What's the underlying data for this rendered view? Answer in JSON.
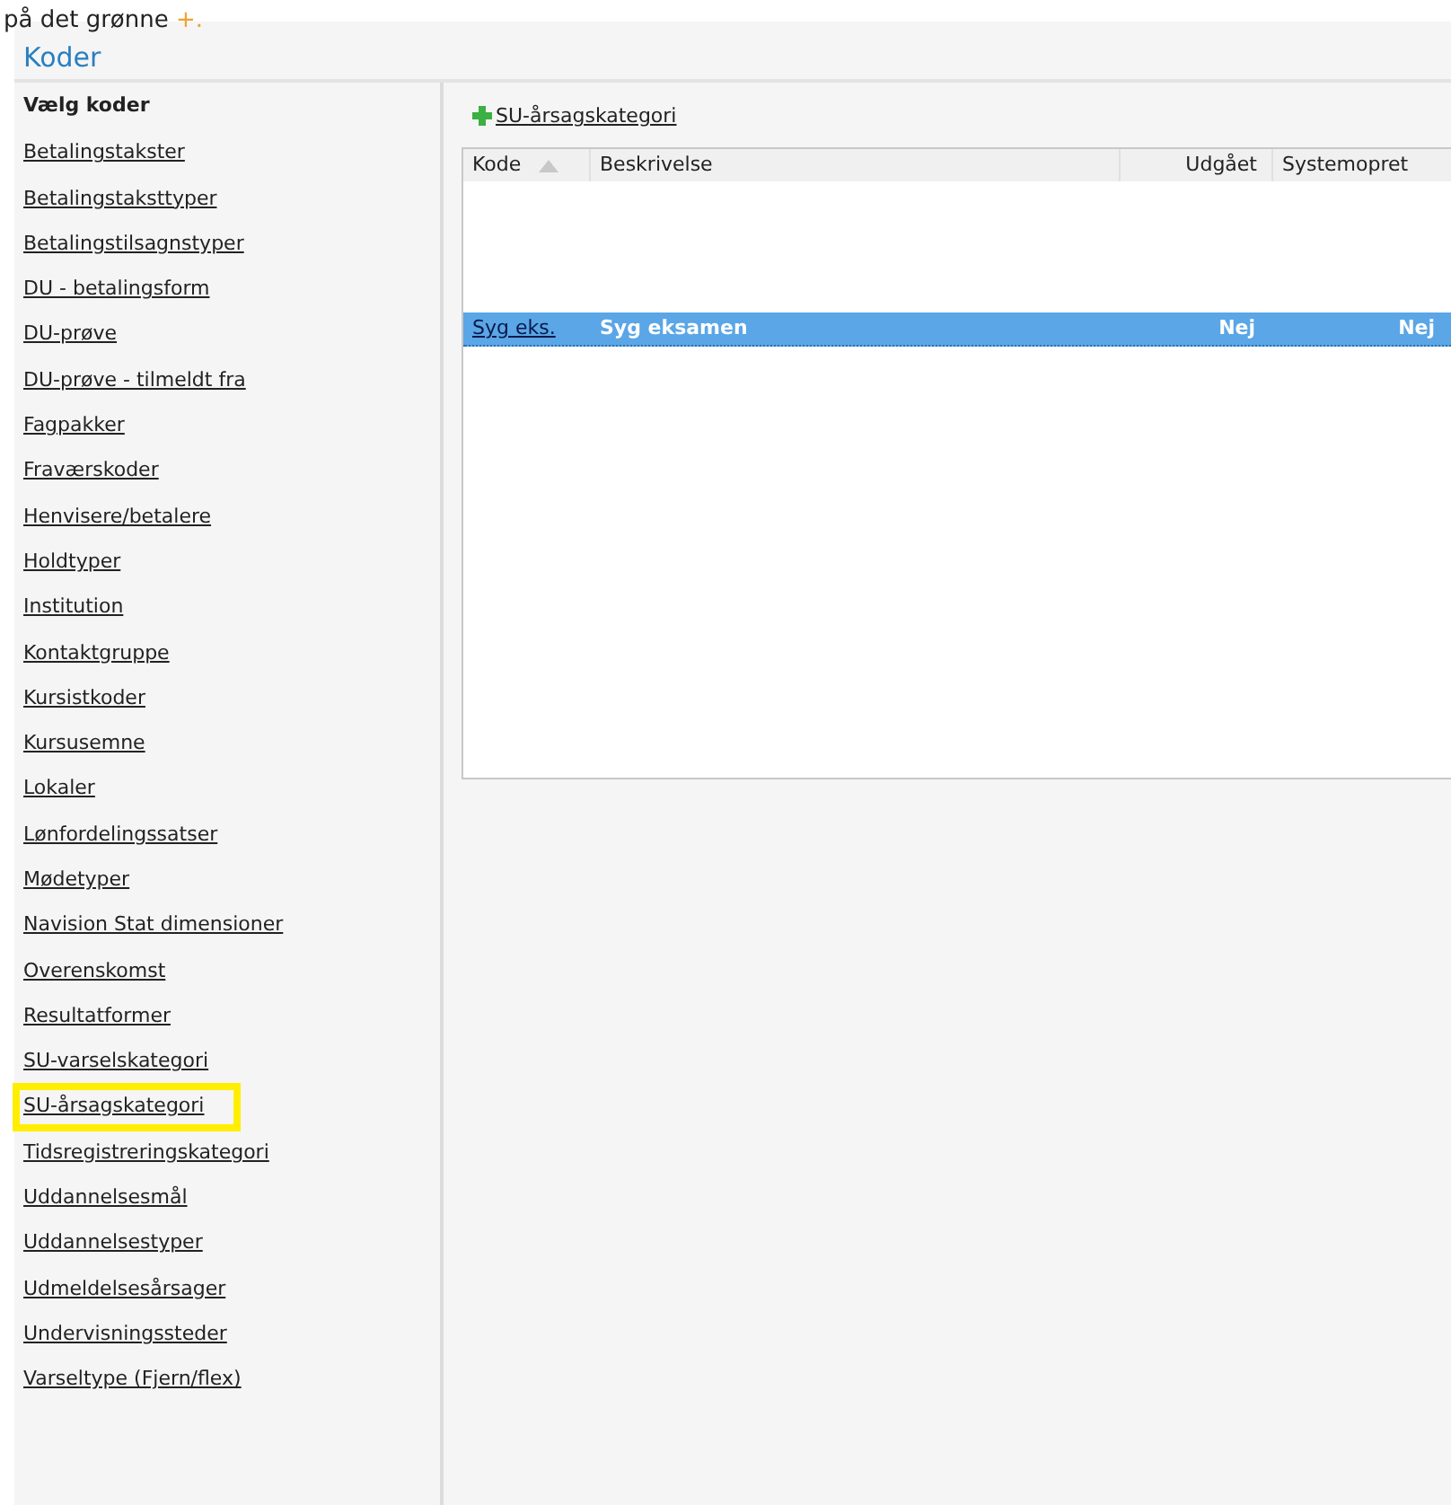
{
  "caption": {
    "text": "på det grønne",
    "mark": "+."
  },
  "panel": {
    "title": "Koder"
  },
  "sidebar": {
    "heading": "Vælg koder",
    "items": [
      {
        "label": "Betalingstakster",
        "highlighted": false
      },
      {
        "label": "Betalingstaksttyper",
        "highlighted": false
      },
      {
        "label": "Betalingstilsagnstyper",
        "highlighted": false
      },
      {
        "label": "DU - betalingsform",
        "highlighted": false
      },
      {
        "label": "DU-prøve",
        "highlighted": false
      },
      {
        "label": "DU-prøve - tilmeldt fra",
        "highlighted": false
      },
      {
        "label": "Fagpakker",
        "highlighted": false
      },
      {
        "label": "Fraværskoder",
        "highlighted": false
      },
      {
        "label": "Henvisere/betalere",
        "highlighted": false
      },
      {
        "label": "Holdtyper",
        "highlighted": false
      },
      {
        "label": "Institution",
        "highlighted": false
      },
      {
        "label": "Kontaktgruppe",
        "highlighted": false
      },
      {
        "label": "Kursistkoder",
        "highlighted": false
      },
      {
        "label": "Kursusemne",
        "highlighted": false
      },
      {
        "label": "Lokaler",
        "highlighted": false
      },
      {
        "label": "Lønfordelingssatser",
        "highlighted": false
      },
      {
        "label": "Mødetyper",
        "highlighted": false
      },
      {
        "label": "Navision Stat dimensioner",
        "highlighted": false
      },
      {
        "label": "Overenskomst",
        "highlighted": false
      },
      {
        "label": "Resultatformer",
        "highlighted": false
      },
      {
        "label": "SU-varselskategori",
        "highlighted": false
      },
      {
        "label": "SU-årsagskategori",
        "highlighted": true
      },
      {
        "label": "Tidsregistreringskategori",
        "highlighted": false
      },
      {
        "label": "Uddannelsesmål",
        "highlighted": false
      },
      {
        "label": "Uddannelsestyper",
        "highlighted": false
      },
      {
        "label": "Udmeldelsesårsager",
        "highlighted": false
      },
      {
        "label": "Undervisningssteder",
        "highlighted": false
      },
      {
        "label": "Varseltype (Fjern/flex)",
        "highlighted": false
      }
    ]
  },
  "content": {
    "add_link": "SU-årsagskategori",
    "table": {
      "columns": [
        "Kode",
        "Beskrivelse",
        "Udgået",
        "Systemopret"
      ],
      "rows": [
        {
          "cells": [
            "Syg eks.",
            "Syg eksamen",
            "Nej",
            "Nej"
          ],
          "selected": true
        }
      ]
    }
  }
}
